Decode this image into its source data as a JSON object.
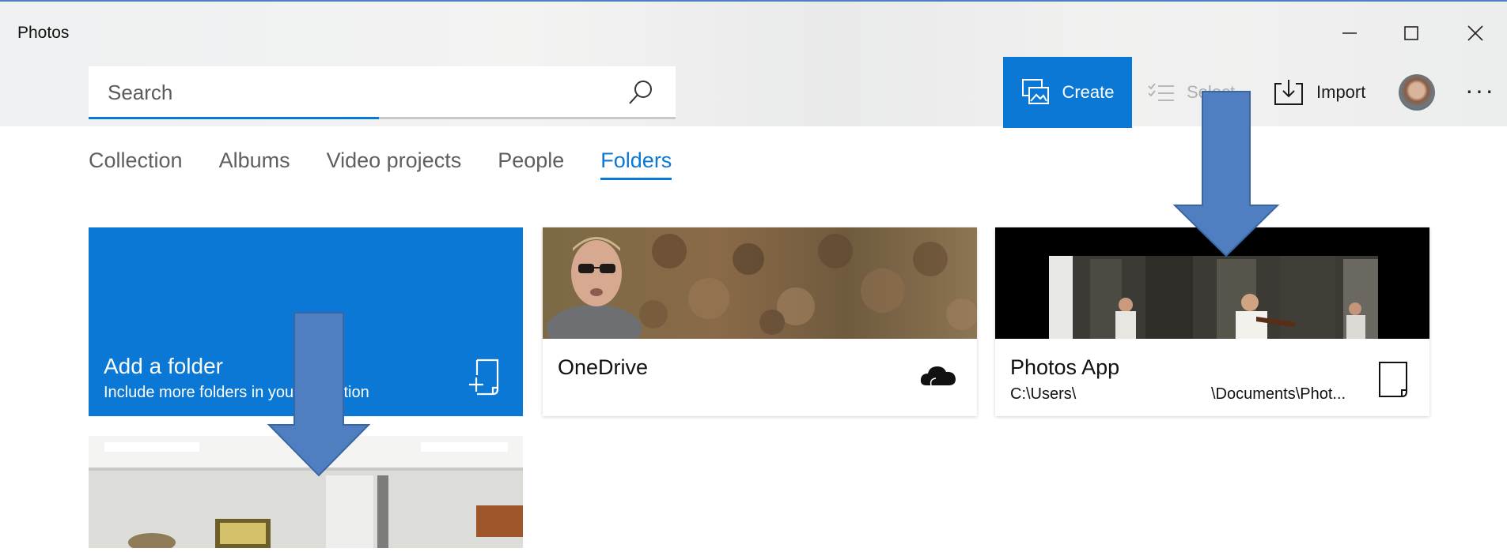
{
  "window": {
    "title": "Photos",
    "minimize_glyph": "—",
    "maximize_glyph": "☐",
    "close_glyph": "✕"
  },
  "search": {
    "placeholder": "Search",
    "icon": "search-icon"
  },
  "toolbar": {
    "create_label": "Create",
    "select_label": "Select",
    "import_label": "Import",
    "more_glyph": "···"
  },
  "tabs": [
    {
      "label": "Collection",
      "active": false
    },
    {
      "label": "Albums",
      "active": false
    },
    {
      "label": "Video projects",
      "active": false
    },
    {
      "label": "People",
      "active": false
    },
    {
      "label": "Folders",
      "active": true
    }
  ],
  "folders": {
    "add": {
      "title": "Add a folder",
      "subtitle": "Include more folders in your collection"
    },
    "onedrive": {
      "name": "OneDrive",
      "icon": "cloud-icon"
    },
    "photos_app": {
      "name": "Photos App",
      "path_start": "C:\\Users\\",
      "path_end": "\\Documents\\Phot..."
    }
  },
  "colors": {
    "accent": "#0a78d4",
    "annotation_arrow": "#4f7fc0"
  }
}
